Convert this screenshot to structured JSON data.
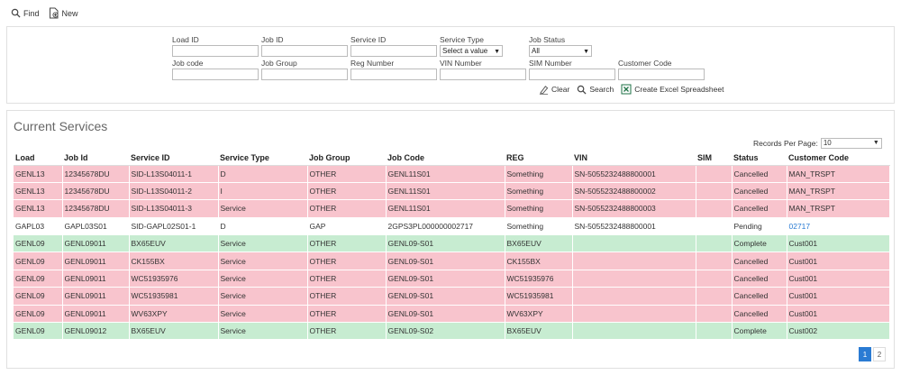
{
  "toolbar": {
    "find_label": "Find",
    "new_label": "New"
  },
  "filters": {
    "row1": [
      {
        "label": "Load ID",
        "value": ""
      },
      {
        "label": "Job ID",
        "value": ""
      },
      {
        "label": "Service ID",
        "value": ""
      },
      {
        "label": "Service Type",
        "value": "Select a value",
        "select": true
      },
      {
        "label": "Job Status",
        "value": "All",
        "select": true
      }
    ],
    "row2": [
      {
        "label": "Job code",
        "value": ""
      },
      {
        "label": "Job Group",
        "value": ""
      },
      {
        "label": "Reg Number",
        "value": ""
      },
      {
        "label": "VIN Number",
        "value": ""
      },
      {
        "label": "SIM Number",
        "value": ""
      },
      {
        "label": "Customer Code",
        "value": ""
      }
    ],
    "actions": {
      "clear": "Clear",
      "search": "Search",
      "excel": "Create Excel Spreadsheet"
    }
  },
  "results": {
    "title": "Current Services",
    "records_per_page_label": "Records Per Page:",
    "records_per_page_value": "10",
    "columns": [
      "Load",
      "Job Id",
      "Service ID",
      "Service Type",
      "Job Group",
      "Job Code",
      "REG",
      "VIN",
      "SIM",
      "Status",
      "Customer Code"
    ],
    "rows": [
      {
        "status_class": "cancelled",
        "cells": [
          "GENL13",
          "12345678DU",
          "SID-L13S04011-1",
          "D",
          "OTHER",
          "GENL11S01",
          "Something",
          "SN-5055232488800001",
          "",
          "Cancelled",
          "MAN_TRSPT"
        ]
      },
      {
        "status_class": "cancelled",
        "cells": [
          "GENL13",
          "12345678DU",
          "SID-L13S04011-2",
          "I",
          "OTHER",
          "GENL11S01",
          "Something",
          "SN-5055232488800002",
          "",
          "Cancelled",
          "MAN_TRSPT"
        ]
      },
      {
        "status_class": "cancelled",
        "cells": [
          "GENL13",
          "12345678DU",
          "SID-L13S04011-3",
          "Service",
          "OTHER",
          "GENL11S01",
          "Something",
          "SN-5055232488800003",
          "",
          "Cancelled",
          "MAN_TRSPT"
        ]
      },
      {
        "status_class": "pending",
        "link_last": true,
        "cells": [
          "GAPL03",
          "GAPL03S01",
          "SID-GAPL02S01-1",
          "D",
          "GAP",
          "2GPS3PL000000002717",
          "Something",
          "SN-5055232488800001",
          "",
          "Pending",
          "02717"
        ]
      },
      {
        "status_class": "complete",
        "cells": [
          "GENL09",
          "GENL09011",
          "BX65EUV",
          "Service",
          "OTHER",
          "GENL09-S01",
          "BX65EUV",
          "",
          "",
          "Complete",
          "Cust001"
        ]
      },
      {
        "status_class": "cancelled",
        "cells": [
          "GENL09",
          "GENL09011",
          "CK155BX",
          "Service",
          "OTHER",
          "GENL09-S01",
          "CK155BX",
          "",
          "",
          "Cancelled",
          "Cust001"
        ]
      },
      {
        "status_class": "cancelled",
        "cells": [
          "GENL09",
          "GENL09011",
          "WC51935976",
          "Service",
          "OTHER",
          "GENL09-S01",
          "WC51935976",
          "",
          "",
          "Cancelled",
          "Cust001"
        ]
      },
      {
        "status_class": "cancelled",
        "cells": [
          "GENL09",
          "GENL09011",
          "WC51935981",
          "Service",
          "OTHER",
          "GENL09-S01",
          "WC51935981",
          "",
          "",
          "Cancelled",
          "Cust001"
        ]
      },
      {
        "status_class": "cancelled",
        "cells": [
          "GENL09",
          "GENL09011",
          "WV63XPY",
          "Service",
          "OTHER",
          "GENL09-S01",
          "WV63XPY",
          "",
          "",
          "Cancelled",
          "Cust001"
        ]
      },
      {
        "status_class": "complete",
        "cells": [
          "GENL09",
          "GENL09012",
          "BX65EUV",
          "Service",
          "OTHER",
          "GENL09-S02",
          "BX65EUV",
          "",
          "",
          "Complete",
          "Cust002"
        ]
      }
    ],
    "pagination": {
      "pages": [
        "1",
        "2"
      ],
      "current": "1"
    }
  },
  "colors": {
    "cancelled": "#f8c4cd",
    "complete": "#c7ecd1",
    "accent": "#2a7bd3"
  }
}
